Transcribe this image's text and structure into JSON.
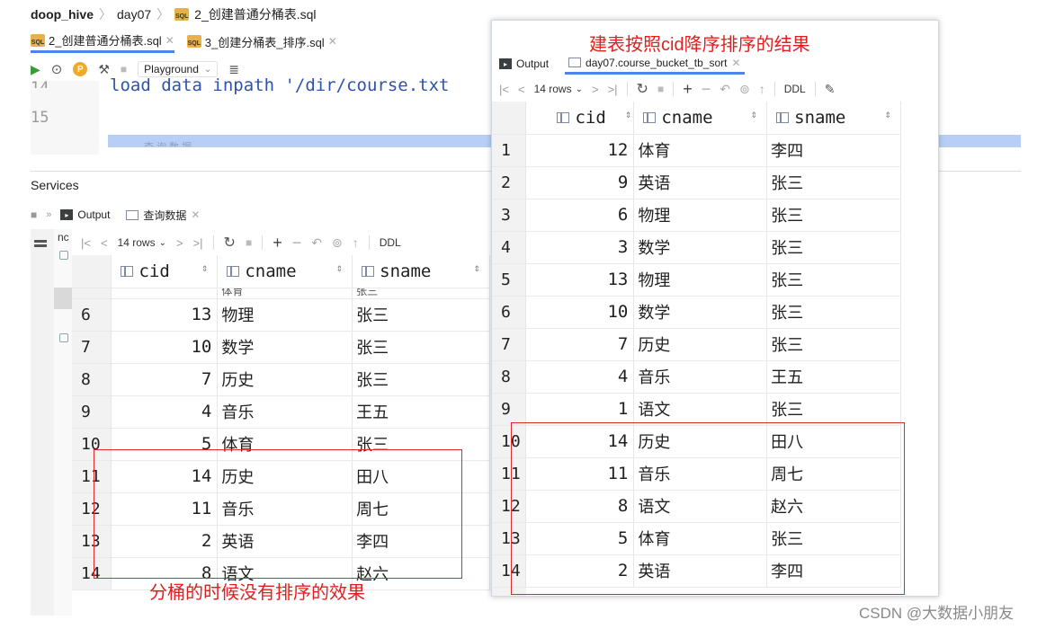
{
  "breadcrumb": {
    "project": "doop_hive",
    "folder": "day07",
    "file": "2_创建普通分桶表.sql"
  },
  "editor_tabs": [
    {
      "label": "2_创建普通分桶表.sql",
      "active": true
    },
    {
      "label": "3_创建分桶表_排序.sql",
      "active": false
    }
  ],
  "toolbar1": {
    "playground": "Playground"
  },
  "editor": {
    "line_numbers": [
      "14",
      "15"
    ],
    "code": "load data inpath '/dir/course.txt",
    "selected_text": "查询数据"
  },
  "services": {
    "title": "Services",
    "tabs": [
      "Output",
      "查询数据"
    ],
    "side_label": "nc",
    "toolbar": {
      "rows": "14 rows",
      "ddl": "DDL"
    }
  },
  "left_table": {
    "columns": [
      "cid",
      "cname",
      "sname"
    ],
    "partial_row": {
      "cname": "体育",
      "sname": "张三"
    },
    "rows": [
      {
        "n": "6",
        "cid": "13",
        "cname": "物理",
        "sname": "张三"
      },
      {
        "n": "7",
        "cid": "10",
        "cname": "数学",
        "sname": "张三"
      },
      {
        "n": "8",
        "cid": "7",
        "cname": "历史",
        "sname": "张三"
      },
      {
        "n": "9",
        "cid": "4",
        "cname": "音乐",
        "sname": "王五"
      },
      {
        "n": "10",
        "cid": "5",
        "cname": "体育",
        "sname": "张三"
      },
      {
        "n": "11",
        "cid": "14",
        "cname": "历史",
        "sname": "田八"
      },
      {
        "n": "12",
        "cid": "11",
        "cname": "音乐",
        "sname": "周七"
      },
      {
        "n": "13",
        "cid": "2",
        "cname": "英语",
        "sname": "李四"
      },
      {
        "n": "14",
        "cid": "8",
        "cname": "语文",
        "sname": "赵六"
      }
    ],
    "caption": "分桶的时候没有排序的效果"
  },
  "right_panel": {
    "title": "建表按照cid降序排序的结果",
    "tabs": [
      "Output",
      "day07.course_bucket_tb_sort"
    ],
    "toolbar": {
      "rows": "14 rows",
      "ddl": "DDL"
    },
    "columns": [
      "cid",
      "cname",
      "sname"
    ],
    "rows": [
      {
        "n": "1",
        "cid": "12",
        "cname": "体育",
        "sname": "李四"
      },
      {
        "n": "2",
        "cid": "9",
        "cname": "英语",
        "sname": "张三"
      },
      {
        "n": "3",
        "cid": "6",
        "cname": "物理",
        "sname": "张三"
      },
      {
        "n": "4",
        "cid": "3",
        "cname": "数学",
        "sname": "张三"
      },
      {
        "n": "5",
        "cid": "13",
        "cname": "物理",
        "sname": "张三"
      },
      {
        "n": "6",
        "cid": "10",
        "cname": "数学",
        "sname": "张三"
      },
      {
        "n": "7",
        "cid": "7",
        "cname": "历史",
        "sname": "张三"
      },
      {
        "n": "8",
        "cid": "4",
        "cname": "音乐",
        "sname": "王五"
      },
      {
        "n": "9",
        "cid": "1",
        "cname": "语文",
        "sname": "张三"
      },
      {
        "n": "10",
        "cid": "14",
        "cname": "历史",
        "sname": "田八"
      },
      {
        "n": "11",
        "cid": "11",
        "cname": "音乐",
        "sname": "周七"
      },
      {
        "n": "12",
        "cid": "8",
        "cname": "语文",
        "sname": "赵六"
      },
      {
        "n": "13",
        "cid": "5",
        "cname": "体育",
        "sname": "张三"
      },
      {
        "n": "14",
        "cid": "2",
        "cname": "英语",
        "sname": "李四"
      }
    ]
  },
  "watermark": "CSDN @大数据小朋友",
  "colors": {
    "annotation_red": "#e02020",
    "selection_blue": "#b7cff5",
    "run_green": "#3a9a3a"
  }
}
